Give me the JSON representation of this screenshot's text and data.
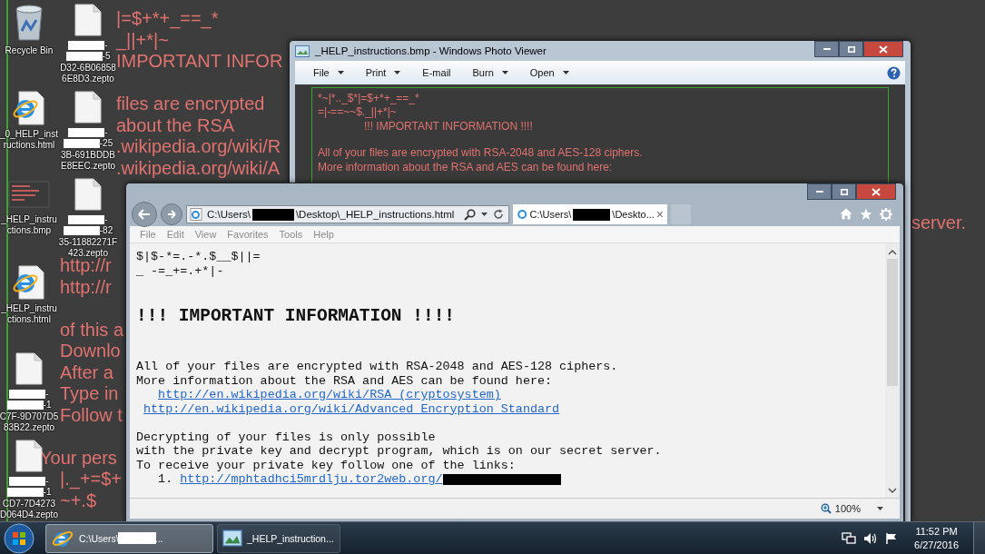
{
  "wallpaper": {
    "upper": [
      [
        "|=$+*+_==_*",
        "_||+*|~",
        "IMPORTANT INFOR"
      ],
      [
        "files are encrypted",
        "about the RSA",
        ".wikipedia.org/wiki/R",
        ".wikipedia.org/wiki/A"
      ]
    ],
    "lower": [
      [
        "http://r",
        "http://r"
      ],
      [
        "of this a",
        "Downlo",
        "After a",
        "Type in",
        "Follow t"
      ],
      [
        "Your pers",
        "|._+=$+",
        "~+.$"
      ]
    ],
    "right_fragment": "server."
  },
  "desktop_columns": [
    [
      {
        "kind": "recycle",
        "lines": [
          {
            "text": "Recycle Bin",
            "redacted": false
          }
        ]
      },
      {
        "kind": "html",
        "lines": [
          {
            "text": "_0_HELP_inst",
            "redacted": false
          },
          {
            "text": "ructions.html",
            "redacted": false
          }
        ]
      },
      {
        "kind": "bmp",
        "lines": [
          {
            "text": "_HELP_instru",
            "redacted": false
          },
          {
            "text": "ctions.bmp",
            "redacted": false
          }
        ]
      },
      {
        "kind": "html",
        "lines": [
          {
            "text": "_HELP_instru",
            "redacted": false
          },
          {
            "text": "ctions.html",
            "redacted": false
          }
        ]
      },
      {
        "kind": "file",
        "lines": [
          {
            "text": "-",
            "redacted": true
          },
          {
            "text": "-1",
            "redacted": true
          },
          {
            "text": "C7F-9D707D5",
            "redacted": false
          },
          {
            "text": "83B22.zepto",
            "redacted": false
          }
        ]
      },
      {
        "kind": "file",
        "lines": [
          {
            "text": "-",
            "redacted": true
          },
          {
            "text": "-1",
            "redacted": true
          },
          {
            "text": "CD7-7D4273",
            "redacted": false
          },
          {
            "text": "D064D4.zepto",
            "redacted": false
          }
        ]
      }
    ],
    [
      {
        "kind": "file",
        "lines": [
          {
            "text": "-",
            "redacted": true
          },
          {
            "text": "-5",
            "redacted": true
          },
          {
            "text": "D32-6B06858",
            "redacted": false
          },
          {
            "text": "6E8D3.zepto",
            "redacted": false
          }
        ]
      },
      {
        "kind": "file",
        "lines": [
          {
            "text": "-",
            "redacted": true
          },
          {
            "text": "-25",
            "redacted": true
          },
          {
            "text": "3B-691BDDB",
            "redacted": false
          },
          {
            "text": "E8EEC.zepto",
            "redacted": false
          }
        ]
      },
      {
        "kind": "file",
        "lines": [
          {
            "text": "-",
            "redacted": true
          },
          {
            "text": "-82",
            "redacted": true
          },
          {
            "text": "35-11882271F",
            "redacted": false
          },
          {
            "text": "423.zepto",
            "redacted": false
          }
        ]
      }
    ]
  ],
  "photo_viewer": {
    "title": "_HELP_instructions.bmp - Windows Photo Viewer",
    "toolbar": [
      {
        "label": "File",
        "dropdown": true
      },
      {
        "label": "Print",
        "dropdown": true
      },
      {
        "label": "E-mail",
        "dropdown": false
      },
      {
        "label": "Burn",
        "dropdown": true
      },
      {
        "label": "Open",
        "dropdown": true
      }
    ],
    "image_blocks": [
      {
        "kind": "text",
        "lines": [
          "*~|*.._$*|=$+*+_==_*",
          "=|-==~~$._||+*|~"
        ]
      },
      {
        "kind": "title",
        "lines": [
          "!!! IMPORTANT INFORMATION !!!!"
        ]
      },
      {
        "kind": "text",
        "lines": [
          "All of your files are encrypted with RSA-2048 and AES-128 ciphers.",
          "More information about the RSA and AES can be found here:"
        ]
      }
    ]
  },
  "browser": {
    "address": {
      "prefix": "C:\\Users\\",
      "suffix": "\\Desktop\\_HELP_instructions.html"
    },
    "tab": {
      "prefix": "C:\\Users\\",
      "suffix": "\\Deskto...",
      "close": "×"
    },
    "menu": [
      "File",
      "Edit",
      "View",
      "Favorites",
      "Tools",
      "Help"
    ],
    "page": [
      {
        "kind": "paragraph",
        "lines": [
          {
            "kind": "text",
            "text": "$|$-*=.-*.$__$||="
          },
          {
            "kind": "text",
            "text": "_ -=_+=.+*|-"
          }
        ]
      },
      {
        "kind": "heading",
        "text": "!!! IMPORTANT INFORMATION !!!!"
      },
      {
        "kind": "paragraph",
        "lines": [
          {
            "kind": "text",
            "text": "All of your files are encrypted with RSA-2048 and AES-128 ciphers."
          },
          {
            "kind": "text",
            "text": "More information about the RSA and AES can be found here:"
          },
          {
            "kind": "link",
            "text": "http://en.wikipedia.org/wiki/RSA_(cryptosystem)",
            "indented": true
          },
          {
            "kind": "link",
            "text": "http://en.wikipedia.org/wiki/Advanced_Encryption_Standard",
            "indented": false
          }
        ]
      },
      {
        "kind": "paragraph",
        "lines": [
          {
            "kind": "text",
            "text": "Decrypting of your files is only possible"
          },
          {
            "kind": "text",
            "text": "with the private key and decrypt program, which is on our secret server."
          },
          {
            "kind": "text",
            "text": "To receive your private key follow one of the links:"
          },
          {
            "kind": "numbered_link",
            "number": "1.",
            "text": "http://mphtadhci5mrdlju.tor2web.org/"
          }
        ]
      }
    ],
    "zoom": "100%"
  },
  "taskbar": {
    "buttons": [
      {
        "kind": "browser",
        "text": "C:\\Users\\",
        "after_redaction": "...",
        "selected": true
      },
      {
        "kind": "photo_viewer",
        "text": "_HELP_instruction...",
        "selected": false
      }
    ],
    "time": "11:52 PM",
    "date": "6/27/2016"
  }
}
